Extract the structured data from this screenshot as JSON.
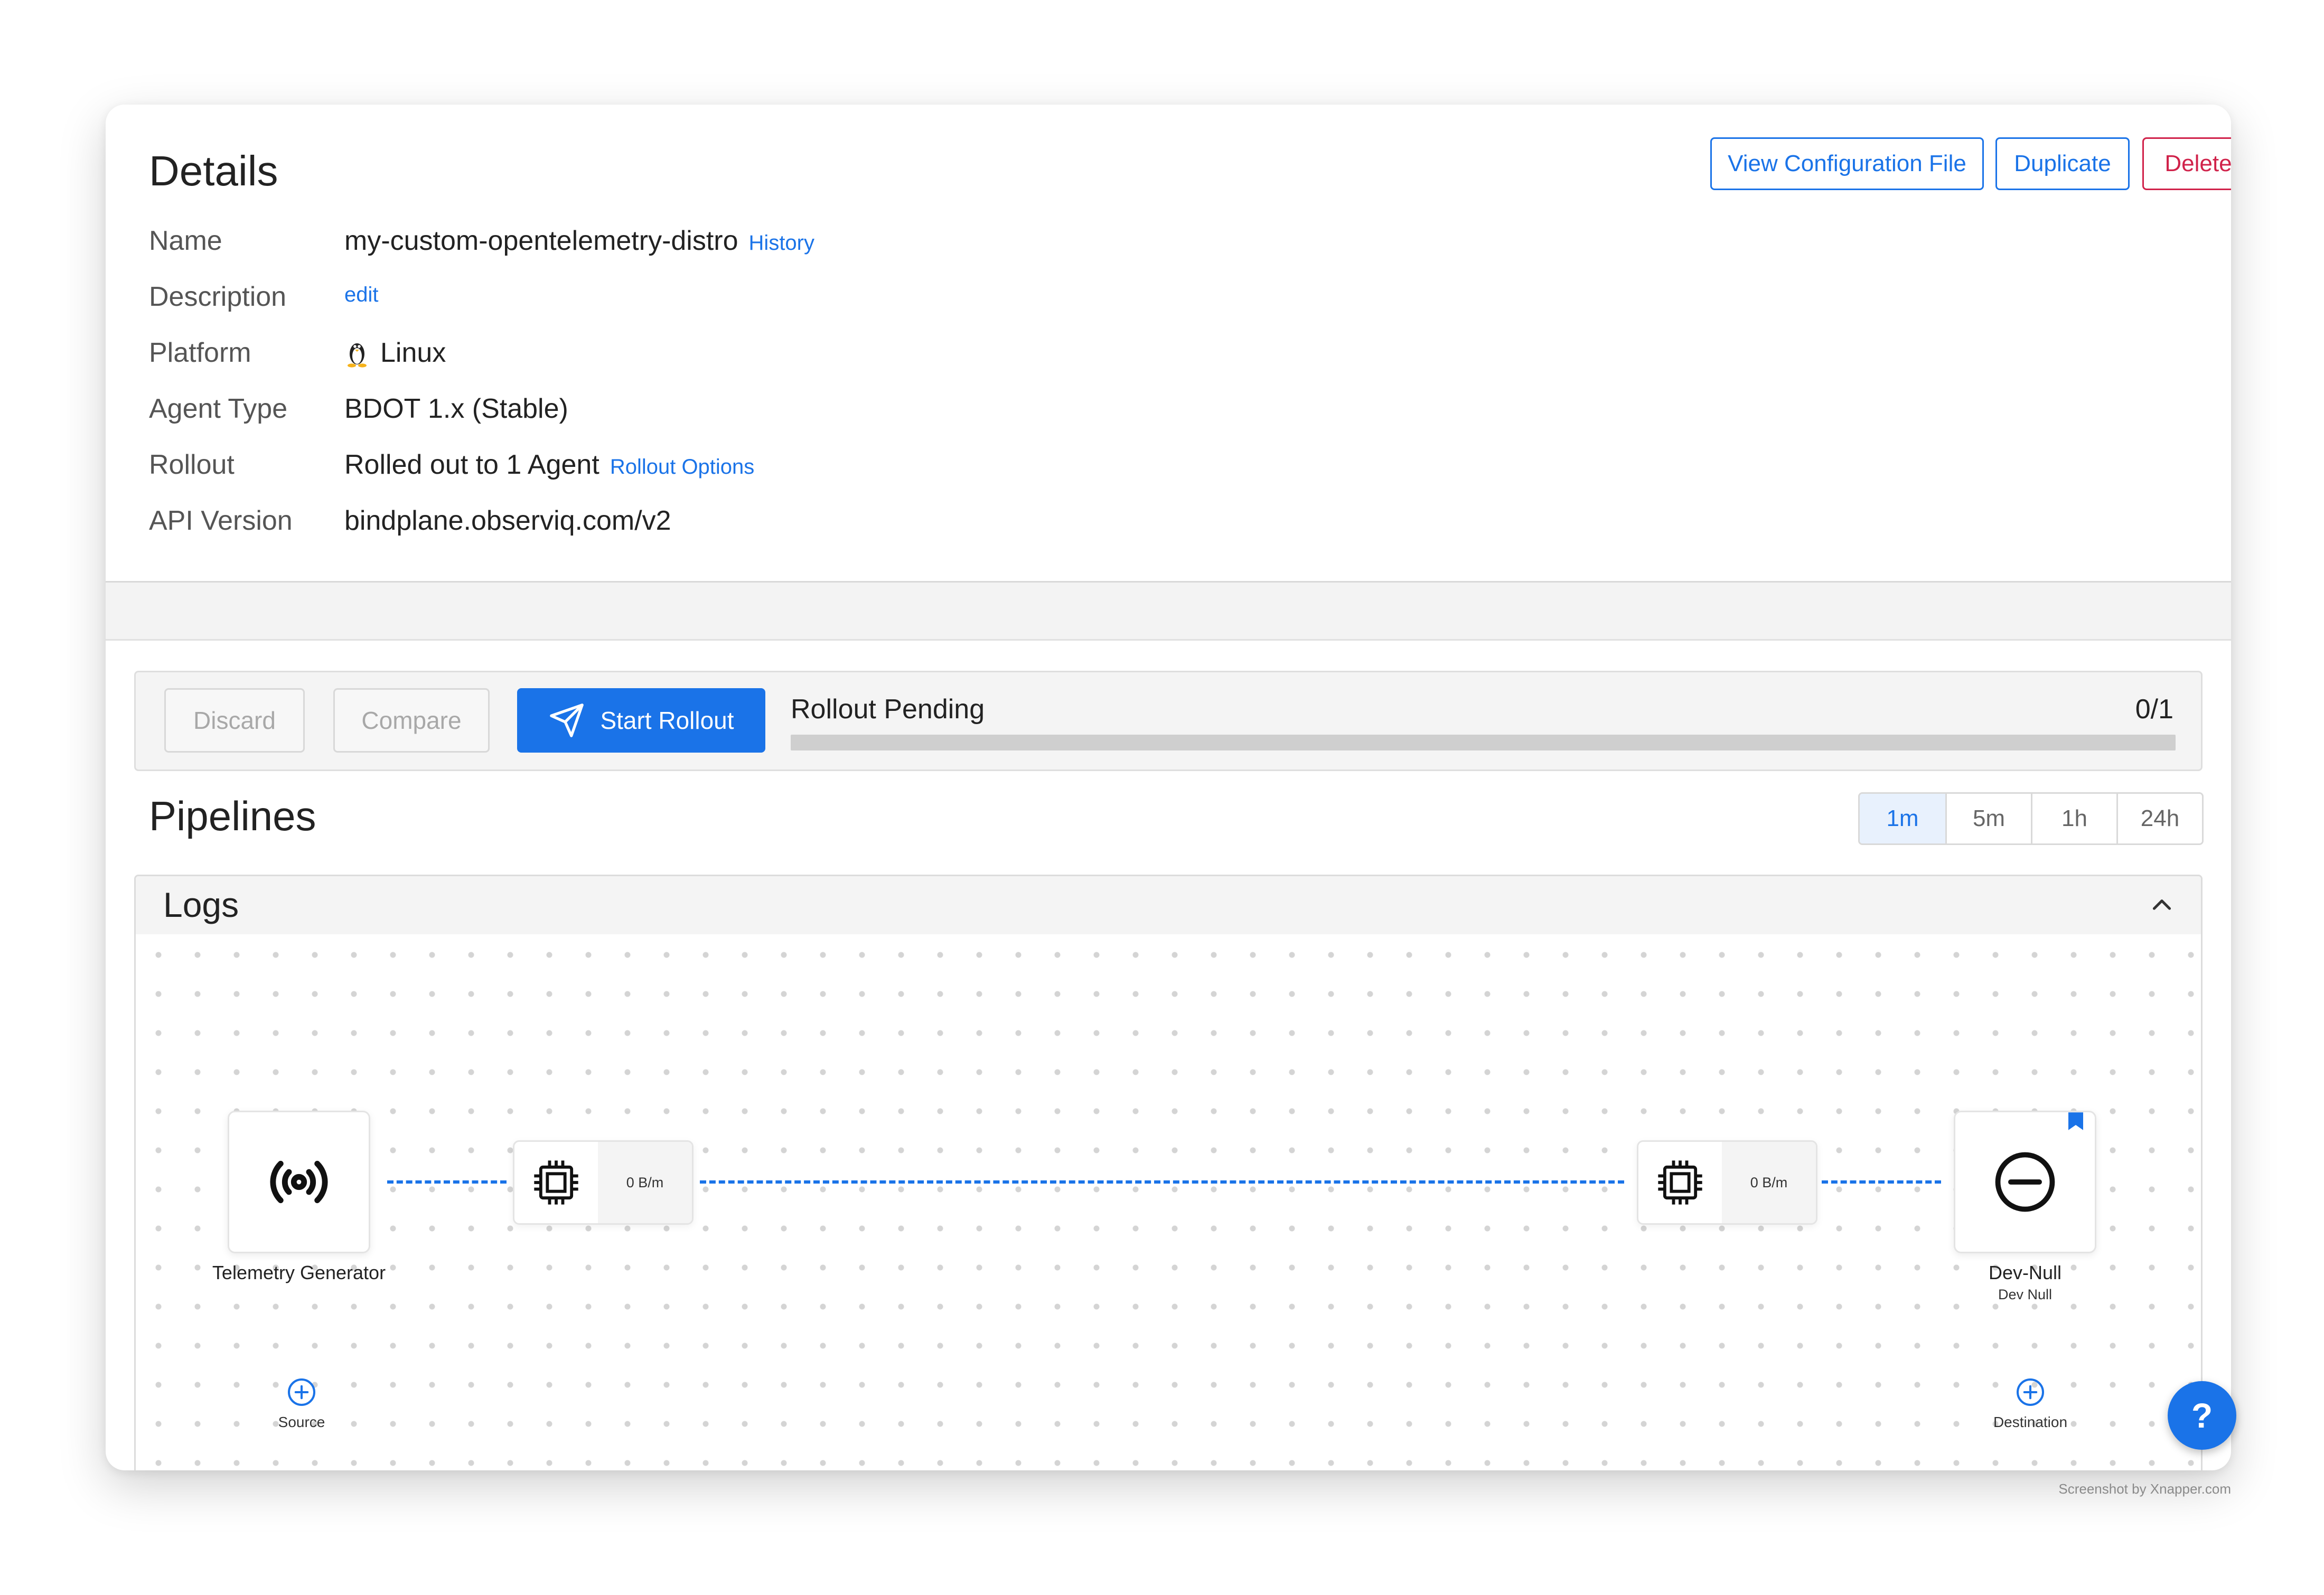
{
  "details": {
    "title": "Details",
    "actions": {
      "view_config": "View Configuration File",
      "duplicate": "Duplicate",
      "delete": "Delete"
    },
    "rows": {
      "name": {
        "label": "Name",
        "value": "my-custom-opentelemetry-distro",
        "link": "History"
      },
      "description": {
        "label": "Description",
        "link": "edit"
      },
      "platform": {
        "label": "Platform",
        "value": "Linux",
        "icon": "linux-penguin-icon"
      },
      "agent_type": {
        "label": "Agent Type",
        "value": "BDOT 1.x (Stable)"
      },
      "rollout": {
        "label": "Rollout",
        "value": "Rolled out to 1 Agent",
        "link": "Rollout Options"
      },
      "api_version": {
        "label": "API Version",
        "value": "bindplane.observiq.com/v2"
      }
    }
  },
  "rollout_bar": {
    "discard": "Discard",
    "compare": "Compare",
    "start": "Start Rollout",
    "status": "Rollout Pending",
    "count": "0/1",
    "progress_fraction": 0
  },
  "pipelines": {
    "title": "Pipelines",
    "ranges": [
      "1m",
      "5m",
      "1h",
      "24h"
    ],
    "active_range": "1m",
    "panel": {
      "title": "Logs",
      "source_node": {
        "label": "Telemetry Generator",
        "icon": "broadcast-icon"
      },
      "processor_left": {
        "rate": "0 B/m",
        "icon": "processor-chip-icon"
      },
      "processor_right": {
        "rate": "0 B/m",
        "icon": "processor-chip-icon"
      },
      "destination_node": {
        "label": "Dev-Null",
        "sublabel": "Dev Null",
        "icon": "minus-circle-icon"
      },
      "add_source": "Source",
      "add_destination": "Destination"
    }
  },
  "help": "?",
  "watermark": "Screenshot by Xnapper.com",
  "colors": {
    "accent": "#1a73e8",
    "danger": "#d0224a",
    "panel_bg": "#f4f4f4"
  }
}
